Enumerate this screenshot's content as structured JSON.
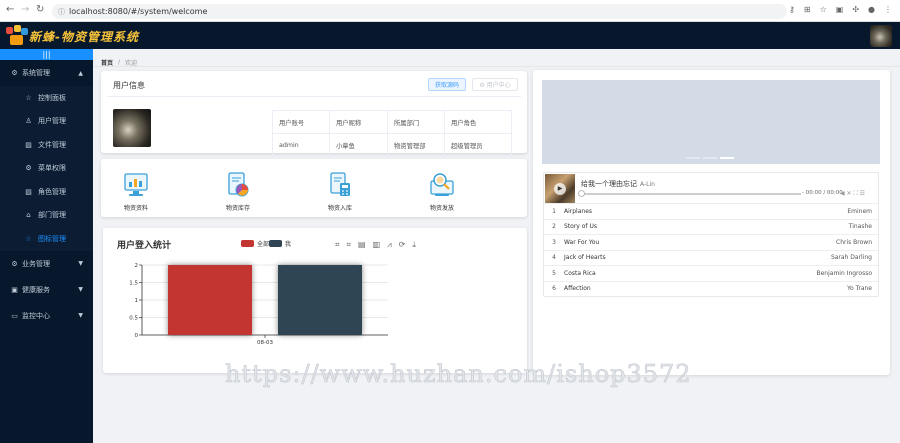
{
  "browser": {
    "url": "localhost:8080/#/system/welcome"
  },
  "app": {
    "title": "新蜂-物资管理系统"
  },
  "sidebar": {
    "collapse_icon": "|||",
    "groups": [
      {
        "label": "系统管理",
        "icon": "gear-icon"
      },
      {
        "label": "业务管理",
        "icon": "gear-icon"
      },
      {
        "label": "健康服务",
        "icon": "document-icon"
      },
      {
        "label": "监控中心",
        "icon": "monitor-icon"
      }
    ],
    "items": [
      {
        "label": "控制面板",
        "icon": "star-icon"
      },
      {
        "label": "用户管理",
        "icon": "user-icon"
      },
      {
        "label": "文件管理",
        "icon": "picture-icon"
      },
      {
        "label": "菜单权限",
        "icon": "gear-icon"
      },
      {
        "label": "角色管理",
        "icon": "picture-icon"
      },
      {
        "label": "部门管理",
        "icon": "home-icon"
      },
      {
        "label": "图标管理",
        "icon": "star-icon"
      }
    ]
  },
  "breadcrumb": {
    "home": "首页",
    "sep": "/",
    "current": "欢迎"
  },
  "user_info": {
    "title": "用户信息",
    "btn_password": "获取源码",
    "btn_center": "⚙ 用户中心",
    "headers": [
      "用户账号",
      "用户昵称",
      "所属部门",
      "用户角色"
    ],
    "values": [
      "admin",
      "小章鱼",
      "物资管理部",
      "超级管理员"
    ]
  },
  "quick": [
    {
      "label": "物资资料"
    },
    {
      "label": "物资库存"
    },
    {
      "label": "物资入库"
    },
    {
      "label": "物资发放"
    }
  ],
  "chart": {
    "title": "用户登入统计",
    "legend": [
      "全部",
      "我"
    ],
    "colors": [
      "#c23531",
      "#2f4554"
    ],
    "toolbox": [
      "⌗",
      "⌗",
      "▤",
      "▥",
      "⩘",
      "⟳",
      "⤓"
    ]
  },
  "chart_data": {
    "type": "bar",
    "categories": [
      "08-03"
    ],
    "series": [
      {
        "name": "全部",
        "values": [
          2
        ]
      },
      {
        "name": "我",
        "values": [
          2
        ]
      }
    ],
    "yticks": [
      "0",
      "0.5",
      "1",
      "1.5",
      "2"
    ],
    "ylim": [
      0,
      2
    ]
  },
  "player": {
    "song_title": "给我一个理由忘记",
    "artist": "A-Lin",
    "time": "- 00:00 / 00:00",
    "controls": "◀ ✕ ⛶ ☰",
    "playlist": [
      {
        "num": "1",
        "name": "Airplanes",
        "artist": "Eminem"
      },
      {
        "num": "2",
        "name": "Story of Us",
        "artist": "Tinashe"
      },
      {
        "num": "3",
        "name": "War For You",
        "artist": "Chris Brown"
      },
      {
        "num": "4",
        "name": "Jack of Hearts",
        "artist": "Sarah Darling"
      },
      {
        "num": "5",
        "name": "Costa Rica",
        "artist": "Benjamin Ingrosso"
      },
      {
        "num": "6",
        "name": "Affection",
        "artist": "Yo Trane"
      }
    ]
  },
  "watermark": "https://www.huzhan.com/ishop3572"
}
